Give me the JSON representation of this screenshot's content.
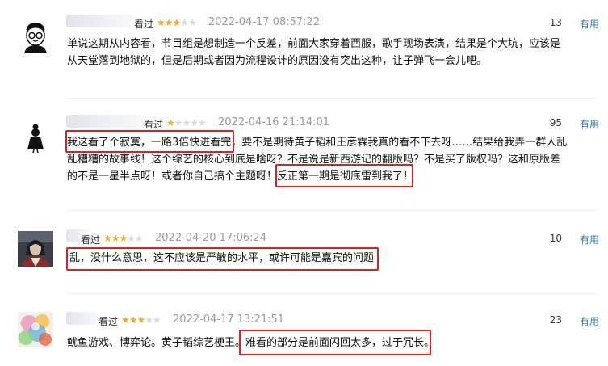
{
  "colors": {
    "star": "#f5a623",
    "useful_link": "#3377aa",
    "highlight_box": "#e0201f",
    "timestamp": "#9a9a9a"
  },
  "comments": [
    {
      "avatar_icon": "glasses-cartoon-avatar-icon",
      "watched_label": "看过",
      "rating": 3,
      "time": "2022-04-17 08:57:22",
      "votes": "13",
      "useful_label": "有用",
      "lines": [
        "单说这期从内容看，节目组是想制造一个反差，前面大家穿着西服，歌手现场表演，结果是个大坑，应该是",
        "从天堂落到地狱的，但是后期或者因为流程设计的原因没有突出这种，让子弹飞一会儿吧。"
      ]
    },
    {
      "avatar_icon": "silhouette-girl-avatar-icon",
      "watched_label": "看过",
      "rating": 1,
      "time": "2022-04-16 21:14:01",
      "votes": "95",
      "useful_label": "有用",
      "lines": [
        "我这看了个寂寞，一路3倍快进看完，要不是期待黄子韬和王彦霖我真的看不下去呀……结果给我弄一群人乱",
        "乱糟糟的故事线！这个综艺的核心到底是啥呀？不是说是新西游记的翻版吗？不是买了版权吗？这和原版差",
        "的不是一星半点呀！或者你自己搞个主题呀！反正第一期是彻底雷到我了！"
      ]
    },
    {
      "avatar_icon": "anime-character-avatar-icon",
      "watched_label": "看过",
      "rating": 3,
      "time": "2022-04-20 17:06:24",
      "votes": "10",
      "useful_label": "有用",
      "lines": [
        "乱，没什么意思，这不应该是严敏的水平，或许可能是嘉宾的问题"
      ]
    },
    {
      "avatar_icon": "colorful-painting-avatar-icon",
      "watched_label": "看过",
      "rating": 3,
      "time": "2022-04-17 13:21:51",
      "votes": "23",
      "useful_label": "有用",
      "lines": [
        "鱿鱼游戏、博弈论。黄子韬综艺梗王。难看的部分是前面闪回太多，过于冗长。"
      ]
    }
  ]
}
